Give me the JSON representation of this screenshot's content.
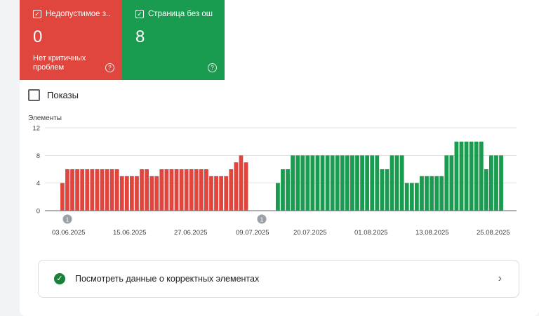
{
  "tiles": [
    {
      "label": "Недопустимое з...",
      "value": "0",
      "sub": "Нет критичных проблем",
      "color": "#e0463d"
    },
    {
      "label": "Страница без ош...",
      "value": "8",
      "sub": "",
      "color": "#199c4f"
    }
  ],
  "impressions_label": "Показы",
  "details": {
    "label": "Посмотреть данные о корректных элементах"
  },
  "chart_data": {
    "type": "bar",
    "ylabel": "Элементы",
    "ylim": [
      0,
      12
    ],
    "yticks": [
      0,
      4,
      8,
      12
    ],
    "xtick_labels": [
      "03.06.2025",
      "15.06.2025",
      "27.06.2025",
      "09.07.2025",
      "20.07.2025",
      "01.08.2025",
      "13.08.2025",
      "25.08.2025"
    ],
    "annotations": [
      "1",
      "1"
    ],
    "series": [
      {
        "color": "#e0463d",
        "values": [
          4,
          6,
          6,
          6,
          6,
          6,
          6,
          6,
          6,
          6,
          6,
          6,
          5,
          5,
          5,
          5,
          6,
          6,
          5,
          5,
          6,
          6,
          6,
          6,
          6,
          6,
          6,
          6,
          6,
          6,
          5,
          5,
          5,
          5,
          6,
          7,
          8,
          7
        ]
      },
      {
        "color": "#199c4f",
        "values": [
          4,
          6,
          6,
          8,
          8,
          8,
          8,
          8,
          8,
          8,
          8,
          8,
          8,
          8,
          8,
          8,
          8,
          8,
          8,
          8,
          8,
          6,
          6,
          8,
          8,
          8,
          4,
          4,
          4,
          5,
          5,
          5,
          5,
          5,
          8,
          8,
          10,
          10,
          10,
          10,
          10,
          10,
          6,
          8,
          8,
          8
        ]
      }
    ]
  }
}
